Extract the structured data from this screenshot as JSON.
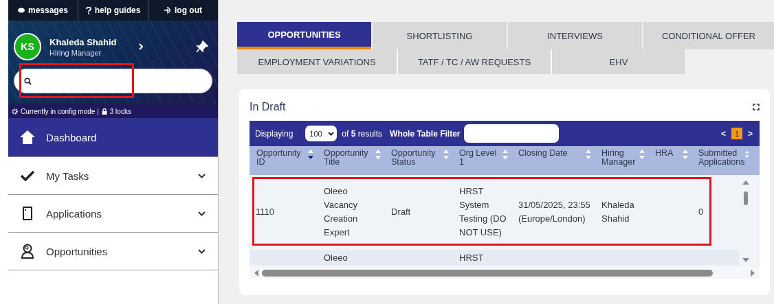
{
  "top_bar": {
    "buttons": [
      {
        "label": "messages"
      },
      {
        "label": "help guides"
      },
      {
        "label": "log out"
      }
    ]
  },
  "profile": {
    "initials": "KS",
    "name": "Khaleda Shahid",
    "role": "Hiring Manager"
  },
  "search": {
    "highlighted": true
  },
  "config_bar": {
    "mode": "Currently in config mode |",
    "locks": "3 locks"
  },
  "sidebar": {
    "items": [
      {
        "label": "Dashboard",
        "selected": true,
        "expandable": false
      },
      {
        "label": "My Tasks",
        "selected": false,
        "expandable": true
      },
      {
        "label": "Applications",
        "selected": false,
        "expandable": true
      },
      {
        "label": "Opportunities",
        "selected": false,
        "expandable": true
      }
    ]
  },
  "tabs": [
    [
      {
        "label": "OPPORTUNITIES",
        "selected": true
      },
      {
        "label": "SHORTLISTING",
        "selected": false
      },
      {
        "label": "INTERVIEWS",
        "selected": false
      },
      {
        "label": "CONDITIONAL OFFER",
        "selected": false
      }
    ],
    [
      {
        "label": "EMPLOYMENT VARIATIONS",
        "selected": false
      },
      {
        "label": "TATF / TC / AW REQUESTS",
        "selected": false
      },
      {
        "label": "EHV",
        "selected": false
      }
    ]
  ],
  "card": {
    "title": "In Draft",
    "toolbar": {
      "displaying": "Displaying",
      "page_size": "100",
      "results": "of **5** results",
      "filter_label": "Whole Table Filter",
      "prev": "<",
      "page": "1",
      "next": ">"
    },
    "table": {
      "columns": [
        {
          "label": "Opportunity ID",
          "sorted": true
        },
        {
          "label": "Opportunity Title",
          "sorted": false
        },
        {
          "label": "Opportunity Status",
          "sorted": false
        },
        {
          "label": "Org Level 1",
          "sorted": false
        },
        {
          "label": "Closing Date",
          "sorted": false
        },
        {
          "label": "Hiring Manager",
          "sorted": false
        },
        {
          "label": "HRA",
          "sorted": false
        },
        {
          "label": "Submitted Applications",
          "sorted": false
        }
      ],
      "rows": [
        {
          "highlighted": true,
          "cells": [
            "1110",
            "Oleeo Vacancy Creation Expert",
            "Draft",
            "HRST System Testing (DO NOT USE)",
            "31/05/2025, 23:55 (Europe/London)",
            "Khaleda Shahid",
            "",
            "0"
          ]
        },
        {
          "highlighted": false,
          "cells": [
            "",
            "Oleeo",
            "",
            "HRST",
            "",
            "",
            "",
            ""
          ]
        }
      ]
    }
  }
}
